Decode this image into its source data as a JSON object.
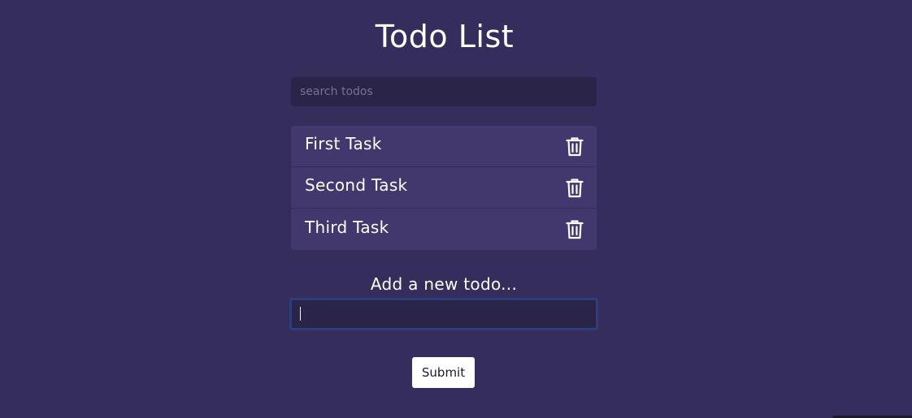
{
  "page": {
    "title": "Todo List",
    "background_color": "#352e5c"
  },
  "search": {
    "placeholder": "search todos",
    "value": ""
  },
  "todos": [
    {
      "text": "First Task",
      "delete_icon": "trash-icon"
    },
    {
      "text": "Second Task",
      "delete_icon": "trash-icon"
    },
    {
      "text": "Third Task",
      "delete_icon": "trash-icon"
    }
  ],
  "add_form": {
    "label": "Add a new todo...",
    "value": "",
    "submit_label": "Submit",
    "focused": true
  },
  "colors": {
    "item_background": "#43386e",
    "input_background": "#2a2548",
    "focus_border": "#2d3f7a",
    "text": "#ffffff"
  }
}
